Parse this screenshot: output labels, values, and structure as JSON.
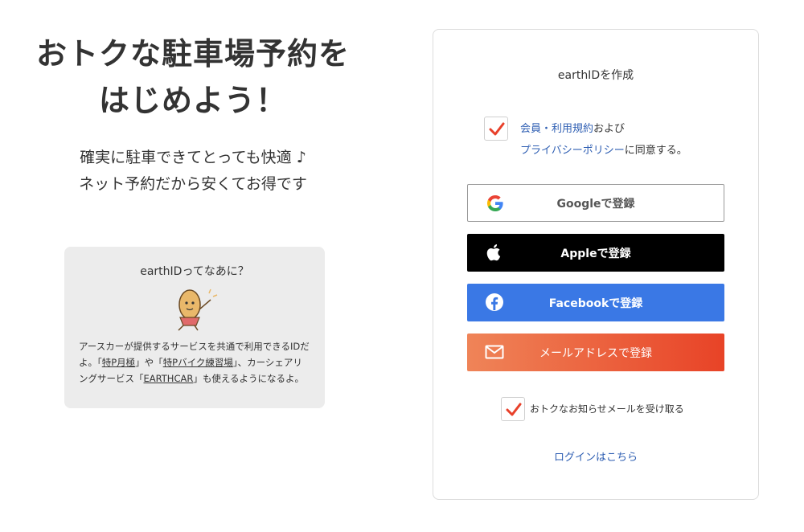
{
  "hero": {
    "title_line1": "おトクな駐車場予約を",
    "title_line2": "はじめよう！",
    "sub_line1": "確実に駐車できてとっても快適 ♪",
    "sub_line2": "ネット予約だから安くてお得です"
  },
  "info": {
    "title": "earthIDってなあに？",
    "text_1": "アースカーが提供するサービスを共通で利用できるIDだよ。「",
    "link_1": "特P月極",
    "text_2": "」や「",
    "link_2": "特Pバイク練習場",
    "text_3": "」、カーシェアリングサービス「",
    "link_3": "EARTHCAR",
    "text_4": "」も使えるようになるよ。"
  },
  "card": {
    "title": "earthIDを作成",
    "terms_link": "会員・利用規約",
    "terms_and": "および",
    "privacy_link": "プライバシーポリシー",
    "agree_text": "に同意する。",
    "google_label": "Googleで登録",
    "apple_label": "Appleで登録",
    "facebook_label": "Facebookで登録",
    "mail_label": "メールアドレスで登録",
    "newsletter_label": "おトクなお知らせメールを受け取る",
    "login_label": "ログインはこちら"
  },
  "colors": {
    "check": "#e8402a",
    "link": "#2f5fb3",
    "facebook": "#3a78e5",
    "mail_start": "#ef8458",
    "mail_end": "#e84327"
  }
}
